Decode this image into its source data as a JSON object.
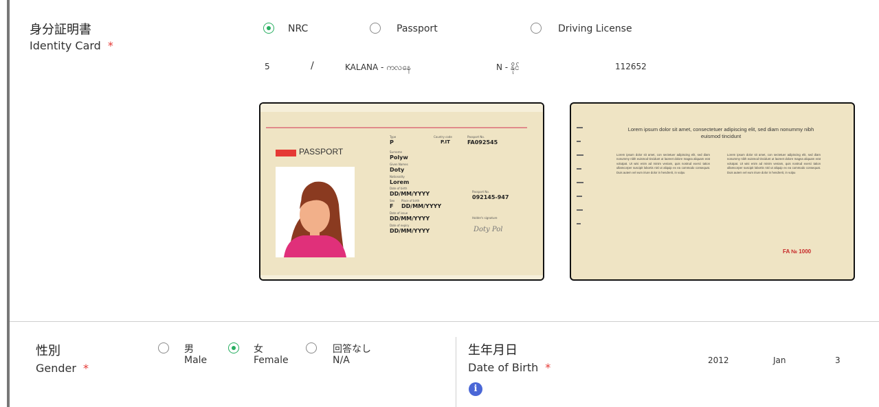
{
  "identity": {
    "label_ja": "身分証明書",
    "label_en": "Identity Card",
    "required_mark": "*",
    "doc_types": [
      {
        "label": "NRC",
        "selected": true
      },
      {
        "label": "Passport",
        "selected": false
      },
      {
        "label": "Driving License",
        "selected": false
      }
    ],
    "nrc": {
      "state": "5",
      "separator": "/",
      "township": "KALANA - ကလနေ",
      "type": "N - နိုင်",
      "number": "112652"
    },
    "front_card": {
      "brand": "PASSPORT",
      "type_label": "Type",
      "type_value": "P",
      "country_label": "Country code",
      "country_value": "P.IT",
      "passport_label": "Passport No.",
      "passport_value": "FA092545",
      "surname_label": "Surname",
      "surname_value": "Polyw",
      "given_label": "Given Names",
      "given_value": "Doty",
      "nationality_label": "Nationality",
      "nationality_value": "Lorem",
      "dob_label": "Date of birth",
      "dob_value": "DD/MM/YYYY",
      "sex_label": "Sex",
      "sex_value": "F",
      "pob_label": "Place of birth",
      "pob_value": "DD/MM/YYYY",
      "issue_label": "Date of issue",
      "issue_value": "DD/MM/YYYY",
      "expiry_label": "Date of expiry",
      "expiry_value": "DD/MM/YYYY",
      "pno2_label": "Passport No.",
      "pno2_value": "092145-947",
      "signature_label": "Holder's signature",
      "signature_value": "Doty Pol"
    },
    "back_card": {
      "heading": "Lorem ipsum dolor sit amet, consectetuer adipiscing elit, sed diam nonummy nibh euismod tincidunt",
      "body_left": "Lorem ipsum dolor sit amet, con sectetuer adipiscing elit, sed diam nonummy nibh euismod tincidunt ut laoreet dolore magna aliquam erat volutpat. Ut wisi enim ad minim veniam, quis nostrud exerci tation ullamcorper suscipit lobortis nisl ut aliquip ex ea commodo consequat. Duis autem vel eum iriure dolor in hendrerit, in vulpu",
      "body_right": "Lorem ipsum dolor sit amet, con sectetuer adipiscing elit, sed diam nonummy nibh euismod tincidunt ut laoreet dolore magna aliquam erat volutpat. Ut wisi enim ad minim veniam, quis nostrud exerci tation ullamcorper suscipit lobortis nisl ut aliquip ex ea commodo consequat. Duis autem vel eum iriure dolor in hendrerit, in vulpu",
      "serial": "FA № 1000"
    }
  },
  "gender": {
    "label_ja": "性別",
    "label_en": "Gender",
    "required_mark": "*",
    "options": [
      {
        "ja": "男",
        "en": "Male",
        "selected": false
      },
      {
        "ja": "女",
        "en": "Female",
        "selected": true
      },
      {
        "ja": "回答なし",
        "en": "N/A",
        "selected": false
      }
    ]
  },
  "dob": {
    "label_ja": "生年月日",
    "label_en": "Date of Birth",
    "required_mark": "*",
    "info_glyph": "i",
    "year": "2012",
    "month": "Jan",
    "day": "3"
  },
  "colors": {
    "accent": "#27ae60",
    "required": "#e53935",
    "info": "#4a67d6",
    "card_bg": "#efe4c4"
  }
}
